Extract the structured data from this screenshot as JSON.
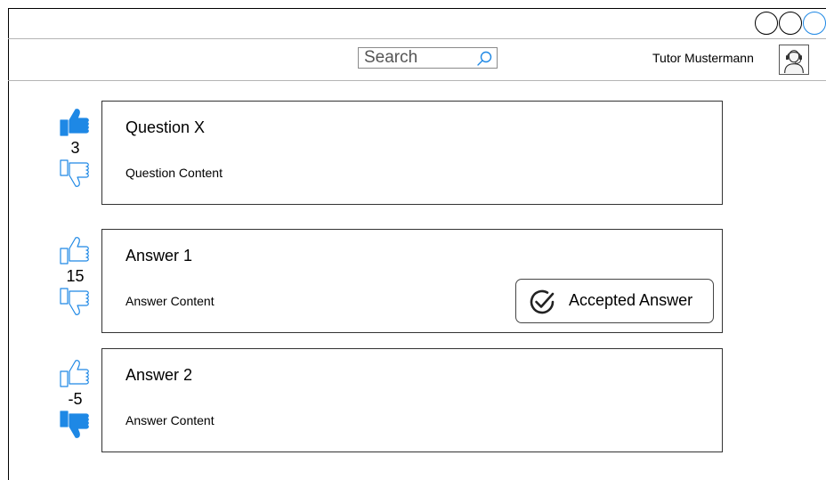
{
  "header": {
    "search": {
      "placeholder": "Search"
    },
    "user": {
      "name": "Tutor Mustermann"
    }
  },
  "colors": {
    "accent": "#1e88e5",
    "border": "#333333"
  },
  "thread": {
    "question": {
      "title": "Question X",
      "content": "Question Content",
      "votes": "3",
      "upvoted": true,
      "downvoted": false
    },
    "answers": [
      {
        "title": "Answer 1",
        "content": "Answer Content",
        "votes": "15",
        "upvoted": false,
        "downvoted": false,
        "accepted": true,
        "accepted_label": "Accepted Answer"
      },
      {
        "title": "Answer 2",
        "content": "Answer Content",
        "votes": "-5",
        "upvoted": false,
        "downvoted": true,
        "accepted": false
      }
    ]
  },
  "icons": {
    "thumb_up": "thumbs-up-icon",
    "thumb_down": "thumbs-down-icon",
    "search": "search-icon",
    "avatar": "user-avatar-icon",
    "accepted": "check-circle-icon"
  }
}
